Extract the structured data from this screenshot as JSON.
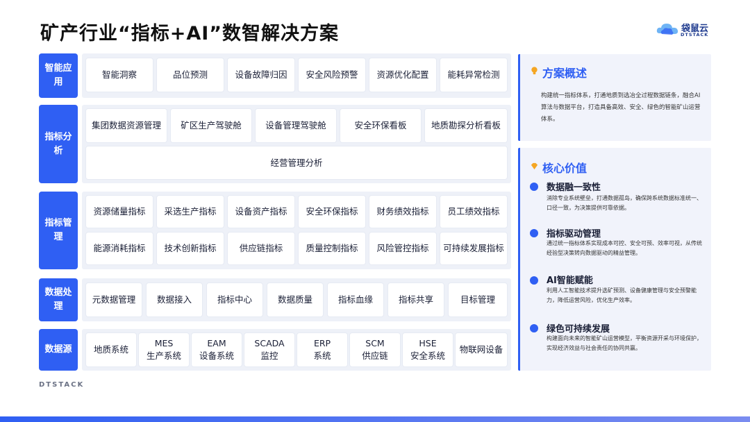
{
  "title": "矿产行业“指标+AI”数智解决方案",
  "logo": {
    "name": "袋鼠云",
    "sub": "DTSTACK"
  },
  "footer": "DTSTACK",
  "layers": {
    "app": {
      "label": "智能应用",
      "items": [
        "智能洞察",
        "品位预测",
        "设备故障归因",
        "安全风险预警",
        "资源优化配置",
        "能耗异常检测"
      ]
    },
    "analysis": {
      "label": "指标分析",
      "items": [
        "集团数据资源管理",
        "矿区生产驾驶舱",
        "设备管理驾驶舱",
        "安全环保看板",
        "地质勘探分析看板"
      ],
      "wide": "经营管理分析"
    },
    "metric": {
      "label": "指标管理",
      "items": [
        "资源储量指标",
        "采选生产指标",
        "设备资产指标",
        "安全环保指标",
        "财务绩效指标",
        "员工绩效指标",
        "能源消耗指标",
        "技术创新指标",
        "供应链指标",
        "质量控制指标",
        "风险管控指标",
        "可持续发展指标"
      ]
    },
    "process": {
      "label": "数据处理",
      "items": [
        "元数据管理",
        "数据接入",
        "指标中心",
        "数据质量",
        "指标血缘",
        "指标共享",
        "目标管理"
      ]
    },
    "source": {
      "label": "数据源",
      "items": [
        [
          "地质系统"
        ],
        [
          "MES",
          "生产系统"
        ],
        [
          "EAM",
          "设备系统"
        ],
        [
          "SCADA",
          "监控"
        ],
        [
          "ERP",
          "系统"
        ],
        [
          "SCM",
          "供应链"
        ],
        [
          "HSE",
          "安全系统"
        ],
        [
          "物联网设备"
        ]
      ]
    }
  },
  "overview": {
    "title": "方案概述",
    "text": "构建统一指标体系，打通地质到选冶全过程数据链条，融合AI算法与数据平台，打造具备高效、安全、绿色的智能矿山运营体系。"
  },
  "values": {
    "title": "核心价值",
    "items": [
      {
        "title": "数据融一致性",
        "text": "消除专业系统壁垒，打通数据孤岛，确保跨系统数据标准统一、口径一致，为决策提供可靠依据。"
      },
      {
        "title": "指标驱动管理",
        "text": "通过统一指标体系实现成本可控、安全可预、效率可视，从传统经验型决策转向数据驱动的精益管理。"
      },
      {
        "title": "AI智能赋能",
        "text": "利用人工智能技术提升选矿预测、设备健康管理与安全预警能力，降低运营风险，优化生产效率。"
      },
      {
        "title": "绿色可持续发展",
        "text": "构建面向未来的智能矿山运营模型，平衡资源开采与环境保护，实现经济效益与社会责任的协同共赢。"
      }
    ]
  },
  "colors": {
    "accent": "#2f5ff3",
    "panel": "#eef1f8",
    "side": "#f1f3fb"
  }
}
